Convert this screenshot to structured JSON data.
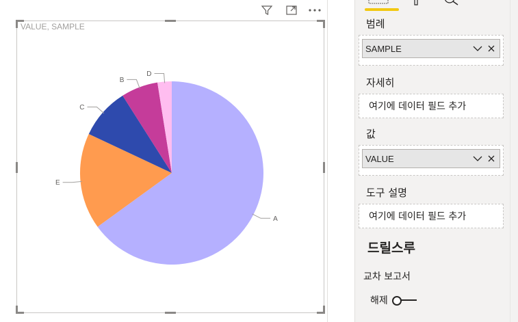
{
  "toolbar": {
    "filter_icon": "filter-icon",
    "focus_icon": "focus-mode-icon",
    "more_icon": "more-options-icon"
  },
  "visual": {
    "title": "VALUE, SAMPLE"
  },
  "chart_data": {
    "type": "pie",
    "title": "VALUE, SAMPLE",
    "categories": [
      "A",
      "E",
      "C",
      "B",
      "D"
    ],
    "values": [
      65,
      17,
      9,
      6.5,
      2.5
    ],
    "colors": [
      "#b5b0ff",
      "#ff9b4f",
      "#2e4aad",
      "#c53c9a",
      "#ffbdf0"
    ],
    "start_angle_deg": 0,
    "direction": "clockwise"
  },
  "pane": {
    "sections": {
      "legend": {
        "title": "범례",
        "field": "SAMPLE"
      },
      "details": {
        "title": "자세히",
        "placeholder": "여기에 데이터 필드 추가"
      },
      "values": {
        "title": "값",
        "field": "VALUE"
      },
      "tooltips": {
        "title": "도구 설명",
        "placeholder": "여기에 데이터 필드 추가"
      }
    },
    "drillthrough": {
      "title": "드릴스루",
      "cross_report_label": "교차 보고서",
      "toggle_label": "해제",
      "toggle_on": false
    },
    "accent": "#f2c811"
  }
}
